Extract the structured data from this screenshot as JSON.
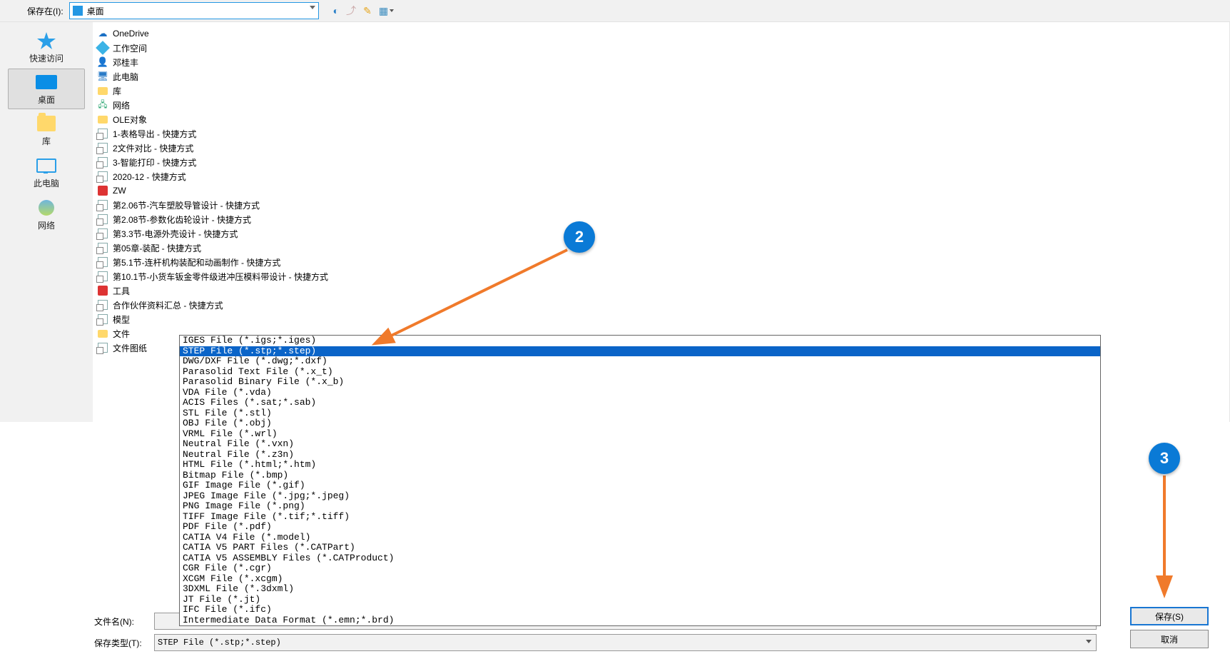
{
  "topbar": {
    "savein_label": "保存在(I):",
    "savein_value": "桌面"
  },
  "sidebar": [
    {
      "key": "quick",
      "label": "快速访问"
    },
    {
      "key": "desktop",
      "label": "桌面",
      "selected": true
    },
    {
      "key": "library",
      "label": "库"
    },
    {
      "key": "thispc",
      "label": "此电脑"
    },
    {
      "key": "network",
      "label": "网络"
    }
  ],
  "files": [
    {
      "icon": "cloud",
      "label": "OneDrive"
    },
    {
      "icon": "diamond",
      "label": "工作空间"
    },
    {
      "icon": "user",
      "label": "邓桂丰"
    },
    {
      "icon": "pc",
      "label": "此电脑"
    },
    {
      "icon": "folder",
      "label": "库"
    },
    {
      "icon": "net",
      "label": "网络"
    },
    {
      "icon": "folder",
      "label": "OLE对象"
    },
    {
      "icon": "shortcut",
      "label": "1-表格导出 - 快捷方式"
    },
    {
      "icon": "shortcut",
      "label": "2文件对比 - 快捷方式"
    },
    {
      "icon": "shortcut",
      "label": "3-智能打印 - 快捷方式"
    },
    {
      "icon": "shortcut",
      "label": "2020-12 - 快捷方式"
    },
    {
      "icon": "red",
      "label": "ZW"
    },
    {
      "icon": "shortcut",
      "label": "第2.06节-汽车塑胶导管设计 - 快捷方式"
    },
    {
      "icon": "shortcut",
      "label": "第2.08节-参数化齿轮设计 - 快捷方式"
    },
    {
      "icon": "shortcut",
      "label": "第3.3节-电源外壳设计 - 快捷方式"
    },
    {
      "icon": "shortcut",
      "label": "第05章-装配 - 快捷方式"
    },
    {
      "icon": "shortcut",
      "label": "第5.1节-连杆机构装配和动画制作 - 快捷方式"
    },
    {
      "icon": "shortcut",
      "label": "第10.1节-小货车钣金零件级进冲压模料带设计 - 快捷方式"
    },
    {
      "icon": "red",
      "label": "工具"
    },
    {
      "icon": "shortcut",
      "label": "合作伙伴资料汇总 - 快捷方式"
    },
    {
      "icon": "shortcut",
      "label": "模型"
    },
    {
      "icon": "folder",
      "label": "文件"
    },
    {
      "icon": "shortcut",
      "label": "文件图纸"
    }
  ],
  "fields": {
    "filename_label": "文件名(N):",
    "filetype_label": "保存类型(T):",
    "filetype_value": "STEP File (*.stp;*.step)"
  },
  "buttons": {
    "save": "保存(S)",
    "cancel": "取消"
  },
  "filetypes": [
    "IGES File (*.igs;*.iges)",
    "STEP File (*.stp;*.step)",
    "DWG/DXF File (*.dwg;*.dxf)",
    "Parasolid Text File (*.x_t)",
    "Parasolid Binary File (*.x_b)",
    "VDA File (*.vda)",
    "ACIS Files (*.sat;*.sab)",
    "STL File (*.stl)",
    "OBJ File (*.obj)",
    "VRML File (*.wrl)",
    "Neutral File (*.vxn)",
    "Neutral File (*.z3n)",
    "HTML File (*.html;*.htm)",
    "Bitmap File (*.bmp)",
    "GIF Image File (*.gif)",
    "JPEG Image File (*.jpg;*.jpeg)",
    "PNG Image File (*.png)",
    "TIFF Image File (*.tif;*.tiff)",
    "PDF File (*.pdf)",
    "CATIA V4 File (*.model)",
    "CATIA V5 PART Files (*.CATPart)",
    "CATIA V5 ASSEMBLY Files (*.CATProduct)",
    "CGR File (*.cgr)",
    "XCGM File (*.xcgm)",
    "3DXML File (*.3dxml)",
    "JT File (*.jt)",
    "IFC File (*.ifc)",
    "Intermediate Data Format (*.emn;*.brd)"
  ],
  "filetype_selected_index": 1,
  "annotations": {
    "badge2": "2",
    "badge3": "3"
  }
}
